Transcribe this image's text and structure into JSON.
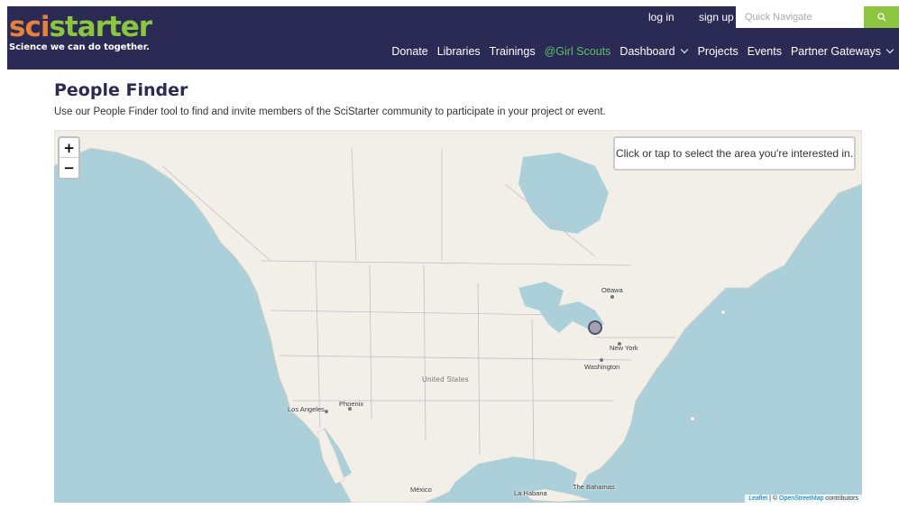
{
  "header": {
    "logo_sci": "sci",
    "logo_starter": "starter",
    "tagline": "Science we can do together.",
    "login": "log in",
    "signup": "sign up",
    "search_placeholder": "Quick Navigate"
  },
  "nav": {
    "items": [
      "Donate",
      "Libraries",
      "Trainings",
      "@Girl Scouts",
      "Dashboard",
      "Projects",
      "Events",
      "Partner Gateways"
    ]
  },
  "page": {
    "title": "People Finder",
    "description": "Use our People Finder tool to find and invite members of the SciStarter community to participate in your project or event."
  },
  "map": {
    "zoom_in": "+",
    "zoom_out": "−",
    "hint": "Click or tap to select the area you're interested in.",
    "labels": {
      "ottawa": "Ottawa",
      "new_york": "New York",
      "washington": "Washington",
      "united_states": "United States",
      "phoenix": "Phoenix",
      "los_angeles": "Los Angeles",
      "mexico": "México",
      "la_habana": "La Habana",
      "bahamas": "The Bahamas"
    },
    "attribution": {
      "leaflet": "Leaflet",
      "separator": " | © ",
      "osm": "OpenStreetMap",
      "suffix": " contributors"
    }
  },
  "colors": {
    "header_bg": "#2a2a55",
    "logo_orange": "#e8823a",
    "logo_green": "#8cc63f",
    "girl_scouts_green": "#5cbf6a",
    "water": "#acd0d9",
    "land": "#f2efe9"
  },
  "icons": {
    "search": "search-icon",
    "dashboard_chevron": "chevron-down-icon",
    "partner_chevron": "chevron-down-icon"
  }
}
